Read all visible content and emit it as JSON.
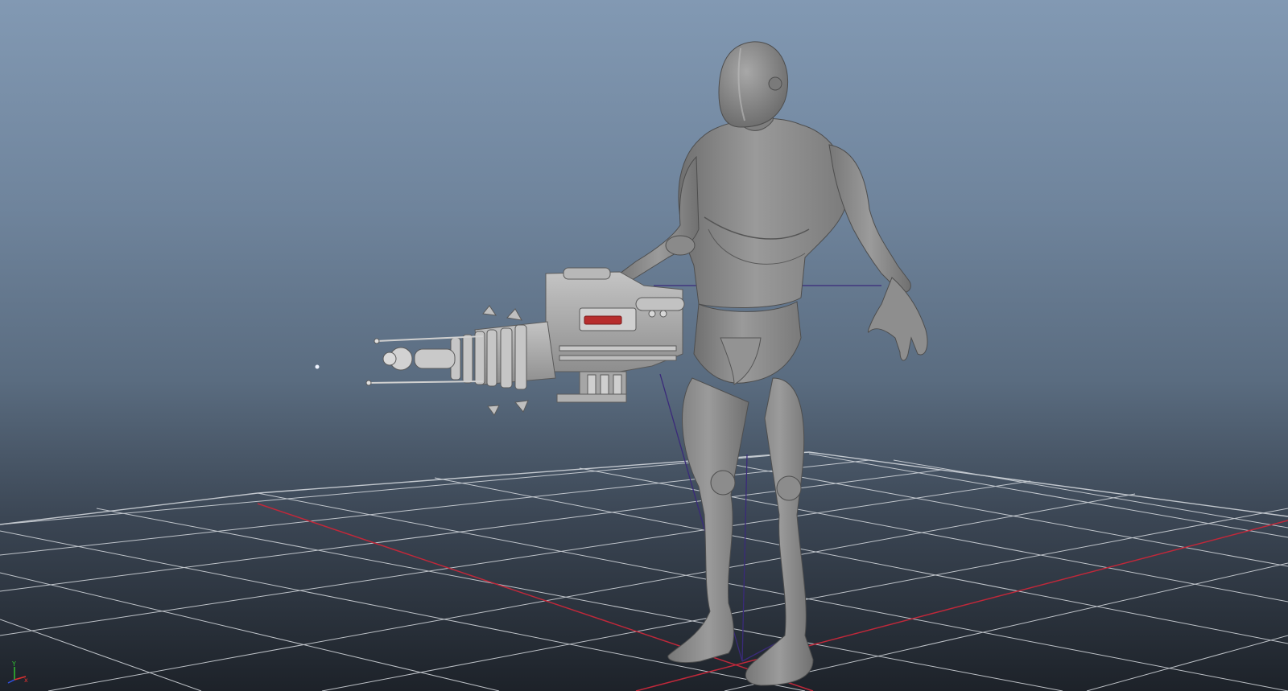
{
  "viewport": {
    "background_top": "#8299b3",
    "background_bottom": "#1d2229",
    "grid_color": "#d9dde2",
    "axis_x_color": "#c0283a",
    "axis_z_color": "#5a2f9a"
  },
  "scene": {
    "objects": [
      "character-mannequin",
      "blaster-weapon",
      "ground-grid",
      "point-light"
    ],
    "model_color": "#8a8a8a",
    "accent_color": "#b72e2e"
  },
  "axis_gizmo": {
    "x_label": "x",
    "y_label": "Y",
    "z_label": "z",
    "x_color": "#e03030",
    "y_color": "#30c030",
    "z_color": "#3050e0"
  }
}
